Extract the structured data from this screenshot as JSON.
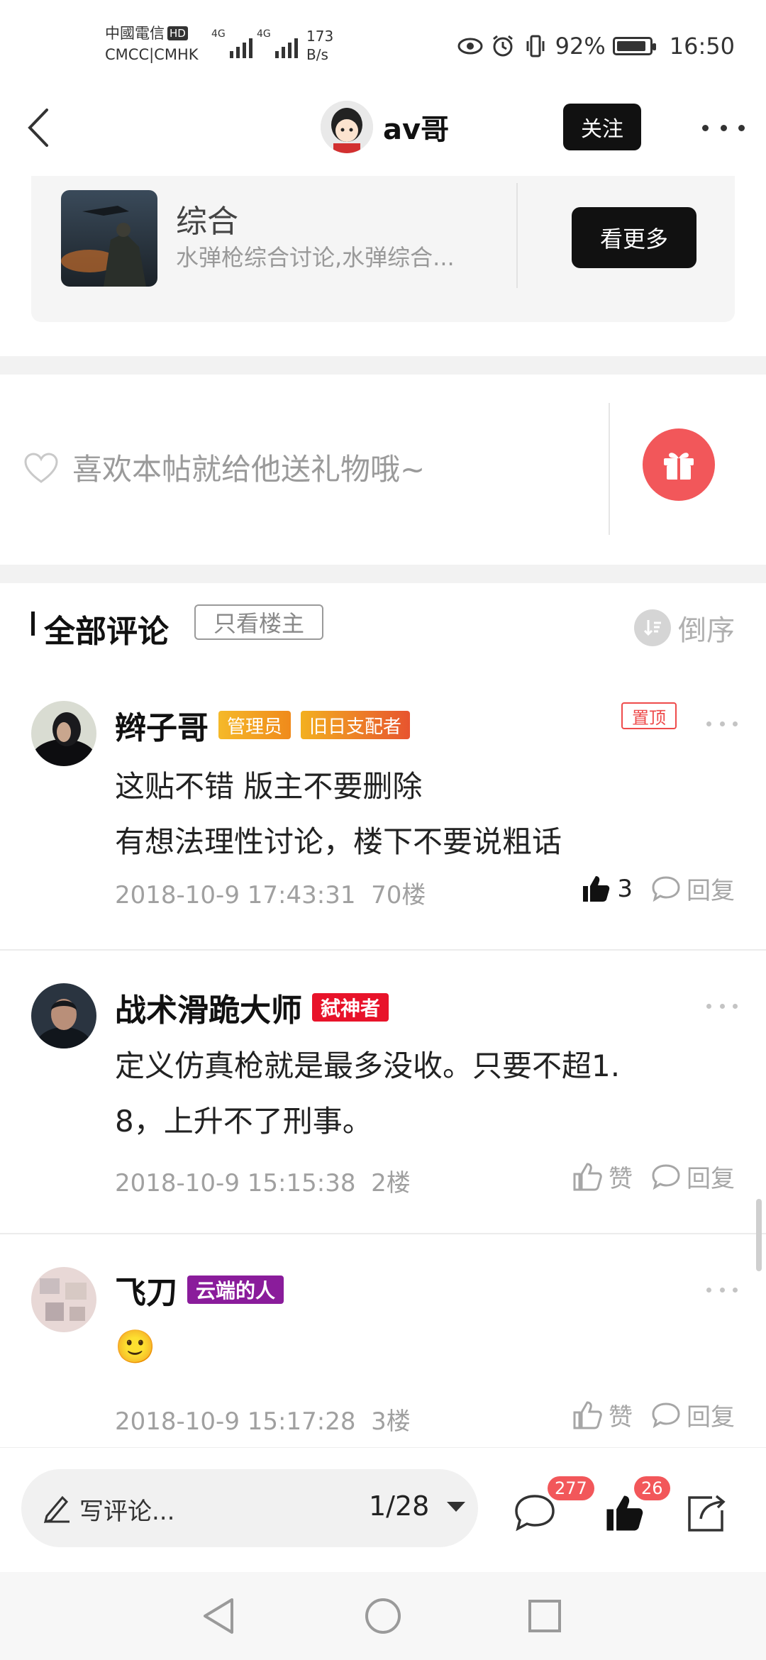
{
  "status_bar": {
    "carrier_line1": "中國電信",
    "hd_badge": "HD",
    "carrier_line2": "CMCC|CMHK",
    "signal1_label": "4G",
    "signal2_label": "4G",
    "net_speed_value": "173",
    "net_speed_unit": "B/s",
    "battery_percent": "92%",
    "time": "16:50"
  },
  "header": {
    "username": "av哥",
    "follow_label": "关注"
  },
  "forum": {
    "name": "综合",
    "description": "水弹枪综合讨论,水弹综合...",
    "see_more_label": "看更多"
  },
  "gift": {
    "prompt": "喜欢本帖就给他送礼物哦~"
  },
  "comments_header": {
    "title": "全部评论",
    "only_owner_label": "只看楼主",
    "sort_label": "倒序"
  },
  "comments": [
    {
      "username": "辫子哥",
      "badges": [
        "管理员",
        "旧日支配者"
      ],
      "pinned_label": "置顶",
      "lines": [
        "这贴不错 版主不要删除",
        "有想法理性讨论，楼下不要说粗话"
      ],
      "timestamp": "2018-10-9 17:43:31",
      "floor": "70楼",
      "like_count": "3",
      "reply_label": "回复"
    },
    {
      "username": "战术滑跪大师",
      "badges": [
        "弑神者"
      ],
      "lines": [
        "定义仿真枪就是最多没收。只要不超1.",
        "8，上升不了刑事。"
      ],
      "timestamp": "2018-10-9 15:15:38",
      "floor": "2楼",
      "like_label": "赞",
      "reply_label": "回复"
    },
    {
      "username": "飞刀",
      "badges": [
        "云端的人"
      ],
      "emoji": "🙂",
      "timestamp": "2018-10-9 15:17:28",
      "floor": "3楼",
      "like_label": "赞",
      "reply_label": "回复"
    }
  ],
  "bottom_bar": {
    "write_placeholder": "写评论...",
    "page_indicator": "1/28",
    "comment_count": "277",
    "like_count": "26"
  }
}
